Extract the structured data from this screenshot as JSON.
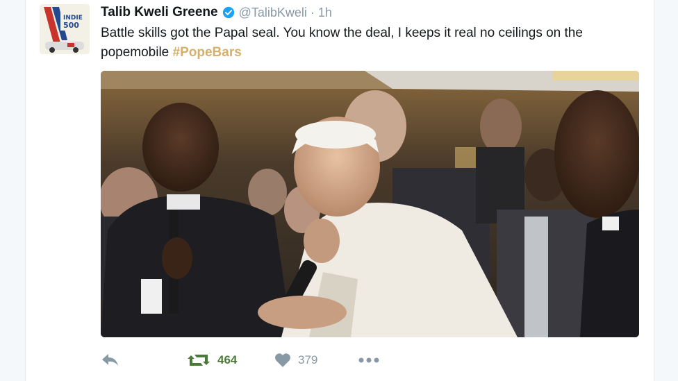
{
  "tweet": {
    "display_name": "Talib Kweli Greene",
    "handle": "@TalibKweli",
    "separator": "·",
    "time": "1h",
    "text_main": "Battle skills got the Papal seal. You know the deal, I keeps it real no ceilings on the popemobile ",
    "hashtag": "#PopeBars"
  },
  "actions": {
    "retweet_count": "464",
    "like_count": "379"
  },
  "colors": {
    "accent_hashtag": "#d4b06a",
    "retweet_green": "#4a7a3a",
    "muted": "#8899a6",
    "verified_blue": "#1da1f2"
  }
}
